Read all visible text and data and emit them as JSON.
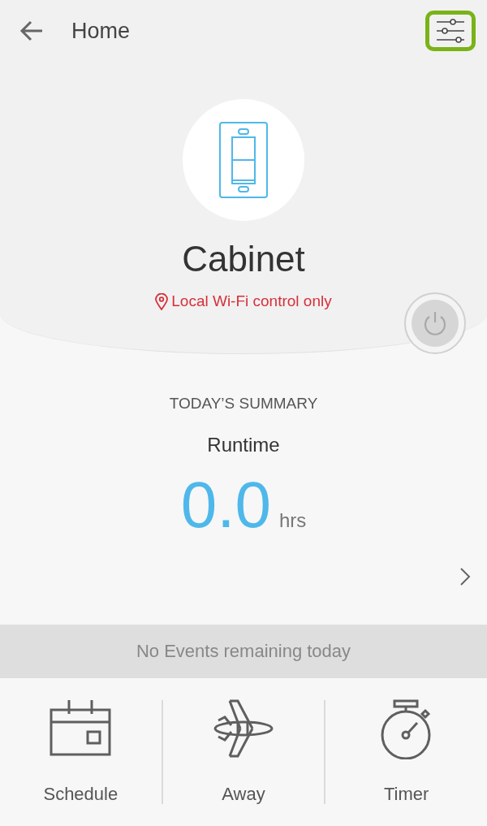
{
  "header": {
    "title": "Home",
    "settings_highlighted": true
  },
  "device": {
    "name": "Cabinet",
    "notice": "Local Wi-Fi control only",
    "power_on": false
  },
  "summary": {
    "heading": "TODAY’S SUMMARY",
    "label": "Runtime",
    "value": "0.0",
    "unit": "hrs"
  },
  "events_banner": "No Events remaining today",
  "bottom_tabs": [
    {
      "kind": "schedule",
      "label": "Schedule"
    },
    {
      "kind": "away",
      "label": "Away"
    },
    {
      "kind": "timer",
      "label": "Timer"
    }
  ]
}
